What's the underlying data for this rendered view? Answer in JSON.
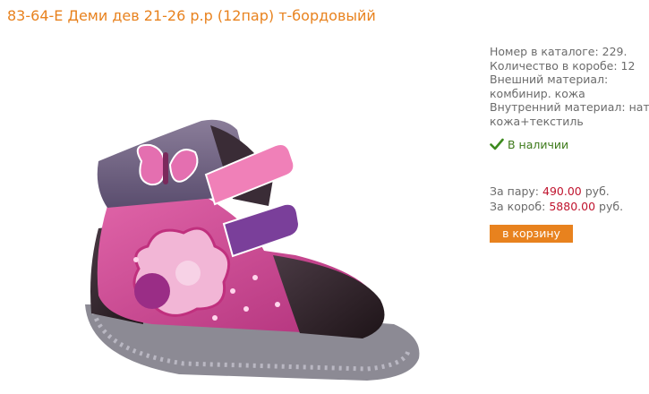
{
  "product": {
    "title": "83-64-Е Деми дев 21-26 р.р (12пар) т-бордовыйй",
    "image_alt": "pink and purple children's ankle boot with butterfly and flower appliqué"
  },
  "details": {
    "catalog_number": "Номер в каталоге: 229.",
    "box_quantity": "Количество в коробе: 12",
    "outer_material_label": "Внешний материал:",
    "outer_material_value": "комбинир. кожа",
    "inner_material_label": "Внутренний материал: нат",
    "inner_material_value": "кожа+текстиль"
  },
  "stock": {
    "icon": "check-icon",
    "label": "В наличии",
    "color": "#3d7a1a"
  },
  "prices": {
    "pair_label": "За пару:",
    "pair_value": "490.00",
    "box_label": "За короб:",
    "box_value": "5880.00",
    "currency": "руб.",
    "price_color": "#c0152f"
  },
  "cart_button": {
    "label": "в корзину",
    "color": "#e8821e"
  },
  "colors": {
    "accent": "#e8821e",
    "text": "#6b6b6b"
  }
}
